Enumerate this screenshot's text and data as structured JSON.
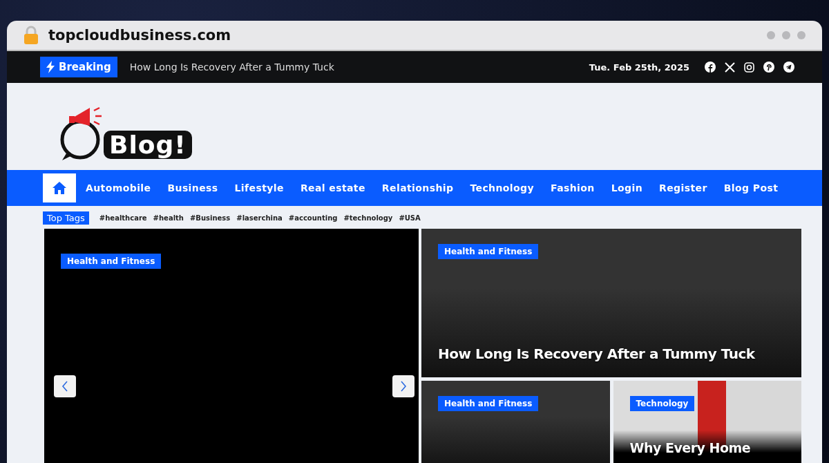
{
  "browser": {
    "address": "topcloudbusiness.com"
  },
  "top_bar": {
    "breaking_label": "Breaking",
    "breaking_headline": "How Long Is Recovery After a Tummy Tuck",
    "date": "Tue. Feb 25th, 2025",
    "social": [
      {
        "kind": "facebook"
      },
      {
        "kind": "x"
      },
      {
        "kind": "instagram"
      },
      {
        "kind": "pinterest"
      },
      {
        "kind": "telegram"
      }
    ]
  },
  "logo": {
    "text": "Blog!"
  },
  "nav": [
    {
      "kind": "home",
      "selected": true
    },
    {
      "kind": "link",
      "label": "Automobile",
      "selected": false
    },
    {
      "kind": "link",
      "label": "Business",
      "selected": false
    },
    {
      "kind": "link",
      "label": "Lifestyle",
      "selected": false
    },
    {
      "kind": "link",
      "label": "Real estate",
      "selected": false
    },
    {
      "kind": "link",
      "label": "Relationship",
      "selected": false
    },
    {
      "kind": "link",
      "label": "Technology",
      "selected": false
    },
    {
      "kind": "link",
      "label": "Fashion",
      "selected": false
    },
    {
      "kind": "link",
      "label": "Login",
      "selected": false
    },
    {
      "kind": "link",
      "label": "Register",
      "selected": false
    },
    {
      "kind": "link",
      "label": "Blog Post",
      "selected": false
    }
  ],
  "top_tags": {
    "title": "Top Tags",
    "tags": [
      "#healthcare",
      "#health",
      "#Business",
      "#laserchina",
      "#accounting",
      "#technology",
      "#USA"
    ]
  },
  "slider": {
    "category": "Health and Fitness"
  },
  "featured": [
    {
      "kind": "dark",
      "category": "Health and Fitness",
      "title": "How Long Is Recovery After a Tummy Tuck"
    },
    {
      "kind": "dark",
      "category": "Health and Fitness"
    },
    {
      "kind": "photo",
      "category": "Technology",
      "title": "Why Every Home"
    }
  ]
}
